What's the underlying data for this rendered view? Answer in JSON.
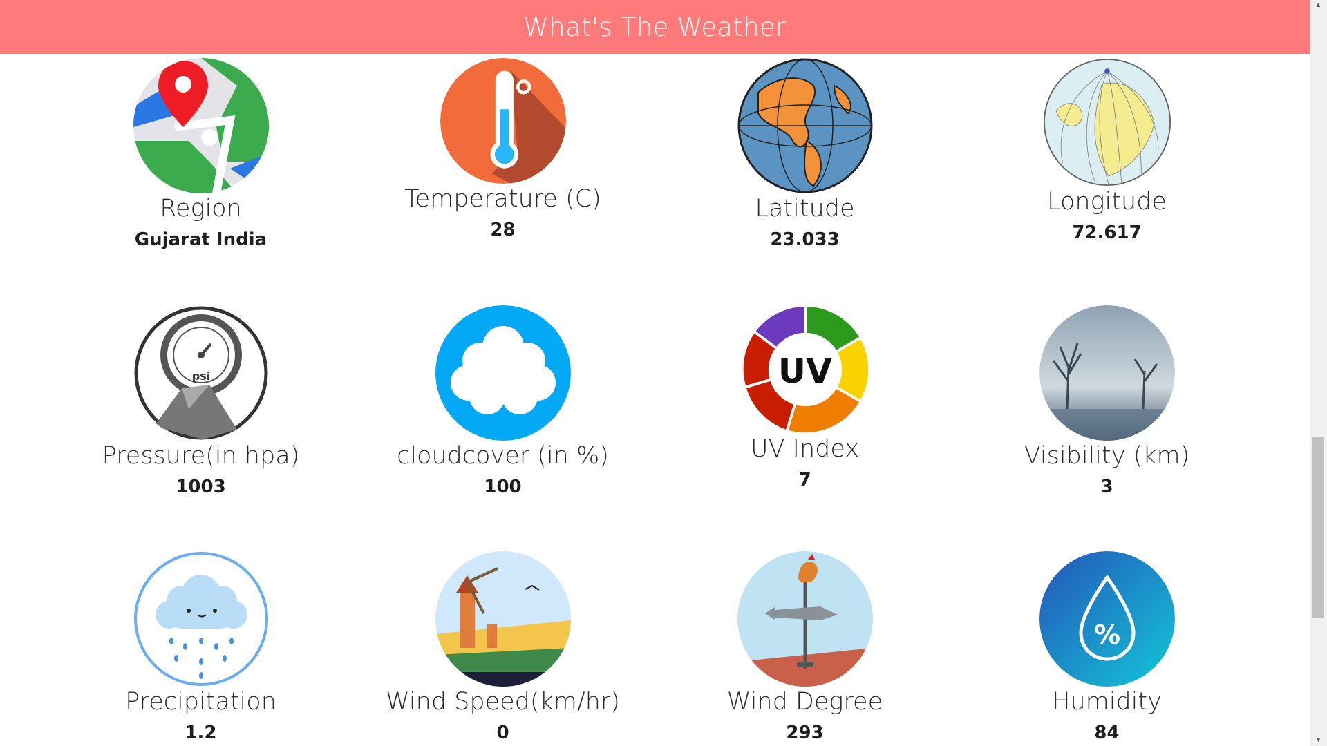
{
  "header": {
    "title": "What's The Weather"
  },
  "colors": {
    "header_bg": "#ff7b7b",
    "header_text": "#ffffff"
  },
  "cards": [
    {
      "label": "Region",
      "value": "Gujarat India",
      "icon": "map-pin-icon"
    },
    {
      "label": "Temperature (C)",
      "value": "28",
      "icon": "thermometer-icon"
    },
    {
      "label": "Latitude",
      "value": "23.033",
      "icon": "globe-icon"
    },
    {
      "label": "Longitude",
      "value": "72.617",
      "icon": "longitude-globe-icon"
    },
    {
      "label": "Pressure(in hpa)",
      "value": "1003",
      "icon": "pressure-gauge-icon"
    },
    {
      "label": "cloudcover (in %)",
      "value": "100",
      "icon": "cloud-icon"
    },
    {
      "label": "UV Index",
      "value": "7",
      "icon": "uv-index-icon"
    },
    {
      "label": "Visibility (km)",
      "value": "3",
      "icon": "fog-trees-icon"
    },
    {
      "label": "Precipitation",
      "value": "1.2",
      "icon": "rain-cloud-icon"
    },
    {
      "label": "Wind Speed(km/hr)",
      "value": "0",
      "icon": "windmill-icon"
    },
    {
      "label": "Wind Degree",
      "value": "293",
      "icon": "weather-vane-icon"
    },
    {
      "label": "Humidity",
      "value": "84",
      "icon": "humidity-drop-icon"
    }
  ]
}
